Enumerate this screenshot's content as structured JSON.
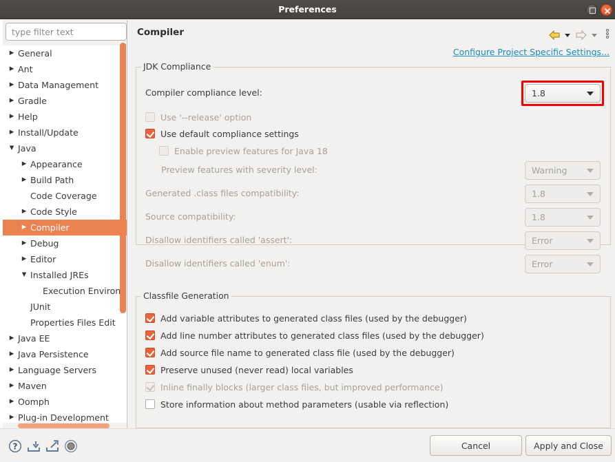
{
  "window": {
    "title": "Preferences",
    "maximize_icon": "maximize-icon",
    "close_icon": "close-icon",
    "accent_orange": "#ec8151",
    "highlight_red": "#f60000",
    "link_blue": "#1a8bbf"
  },
  "sidebar": {
    "filter": {
      "value": "",
      "placeholder": "type filter text"
    },
    "items": [
      {
        "label": "General",
        "indent": 0,
        "arrow": "collapsed",
        "selected": false
      },
      {
        "label": "Ant",
        "indent": 0,
        "arrow": "collapsed",
        "selected": false
      },
      {
        "label": "Data Management",
        "indent": 0,
        "arrow": "collapsed",
        "selected": false
      },
      {
        "label": "Gradle",
        "indent": 0,
        "arrow": "collapsed",
        "selected": false
      },
      {
        "label": "Help",
        "indent": 0,
        "arrow": "collapsed",
        "selected": false
      },
      {
        "label": "Install/Update",
        "indent": 0,
        "arrow": "collapsed",
        "selected": false
      },
      {
        "label": "Java",
        "indent": 0,
        "arrow": "expanded",
        "selected": false
      },
      {
        "label": "Appearance",
        "indent": 1,
        "arrow": "collapsed",
        "selected": false
      },
      {
        "label": "Build Path",
        "indent": 1,
        "arrow": "collapsed",
        "selected": false
      },
      {
        "label": "Code Coverage",
        "indent": 1,
        "arrow": "none",
        "selected": false
      },
      {
        "label": "Code Style",
        "indent": 1,
        "arrow": "collapsed",
        "selected": false
      },
      {
        "label": "Compiler",
        "indent": 1,
        "arrow": "collapsed",
        "selected": true
      },
      {
        "label": "Debug",
        "indent": 1,
        "arrow": "collapsed",
        "selected": false
      },
      {
        "label": "Editor",
        "indent": 1,
        "arrow": "collapsed",
        "selected": false
      },
      {
        "label": "Installed JREs",
        "indent": 1,
        "arrow": "expanded",
        "selected": false
      },
      {
        "label": "Execution Environ",
        "indent": 2,
        "arrow": "none",
        "selected": false
      },
      {
        "label": "JUnit",
        "indent": 1,
        "arrow": "none",
        "selected": false
      },
      {
        "label": "Properties Files Edit",
        "indent": 1,
        "arrow": "none",
        "selected": false
      },
      {
        "label": "Java EE",
        "indent": 0,
        "arrow": "collapsed",
        "selected": false
      },
      {
        "label": "Java Persistence",
        "indent": 0,
        "arrow": "collapsed",
        "selected": false
      },
      {
        "label": "Language Servers",
        "indent": 0,
        "arrow": "collapsed",
        "selected": false
      },
      {
        "label": "Maven",
        "indent": 0,
        "arrow": "collapsed",
        "selected": false
      },
      {
        "label": "Oomph",
        "indent": 0,
        "arrow": "collapsed",
        "selected": false
      },
      {
        "label": "Plug-in Development",
        "indent": 0,
        "arrow": "collapsed",
        "selected": false
      }
    ]
  },
  "pane": {
    "title": "Compiler",
    "nav": {
      "back_icon": "arrow-back-icon",
      "back_menu_icon": "chevron-down-icon",
      "forward_icon": "arrow-forward-icon",
      "forward_menu_icon": "chevron-down-icon",
      "overflow_icon": "view-menu-icon"
    },
    "configure_link": "Configure Project Specific Settings..."
  },
  "jdk_compliance": {
    "group_title": "JDK Compliance",
    "compliance_level": {
      "label": "Compiler compliance level:",
      "value": "1.8",
      "highlighted": true
    },
    "use_release_option": {
      "label": "Use '--release' option",
      "checked": false,
      "enabled": false
    },
    "use_default_compliance": {
      "label": "Use default compliance settings",
      "checked": true,
      "enabled": true
    },
    "enable_preview": {
      "label": "Enable preview features for Java 18",
      "checked": false,
      "enabled": false
    },
    "rows": [
      {
        "label": "Preview features with severity level:",
        "value": "Warning",
        "enabled": false,
        "indent": 36
      },
      {
        "label": "Generated .class files compatibility:",
        "value": "1.8",
        "enabled": false,
        "indent": 13
      },
      {
        "label": "Source compatibility:",
        "value": "1.8",
        "enabled": false,
        "indent": 13
      },
      {
        "label": "Disallow identifiers called 'assert':",
        "value": "Error",
        "enabled": false,
        "indent": 13
      },
      {
        "label": "Disallow identifiers called 'enum':",
        "value": "Error",
        "enabled": false,
        "indent": 13
      }
    ]
  },
  "classfile_generation": {
    "group_title": "Classfile Generation",
    "items": [
      {
        "label": "Add variable attributes to generated class files (used by the debugger)",
        "checked": true,
        "enabled": true
      },
      {
        "label": "Add line number attributes to generated class files (used by the debugger)",
        "checked": true,
        "enabled": true
      },
      {
        "label": "Add source file name to generated class file (used by the debugger)",
        "checked": true,
        "enabled": true
      },
      {
        "label": "Preserve unused (never read) local variables",
        "checked": true,
        "enabled": true
      },
      {
        "label": "Inline finally blocks (larger class files, but improved performance)",
        "checked": true,
        "enabled": false
      },
      {
        "label": "Store information about method parameters (usable via reflection)",
        "checked": false,
        "enabled": true
      }
    ]
  },
  "bottom": {
    "help_icon": "help-icon",
    "import_icon": "import-icon",
    "export_icon": "export-icon",
    "restore_icon": "record-icon",
    "cancel_label": "Cancel",
    "apply_label": "Apply and Close"
  }
}
